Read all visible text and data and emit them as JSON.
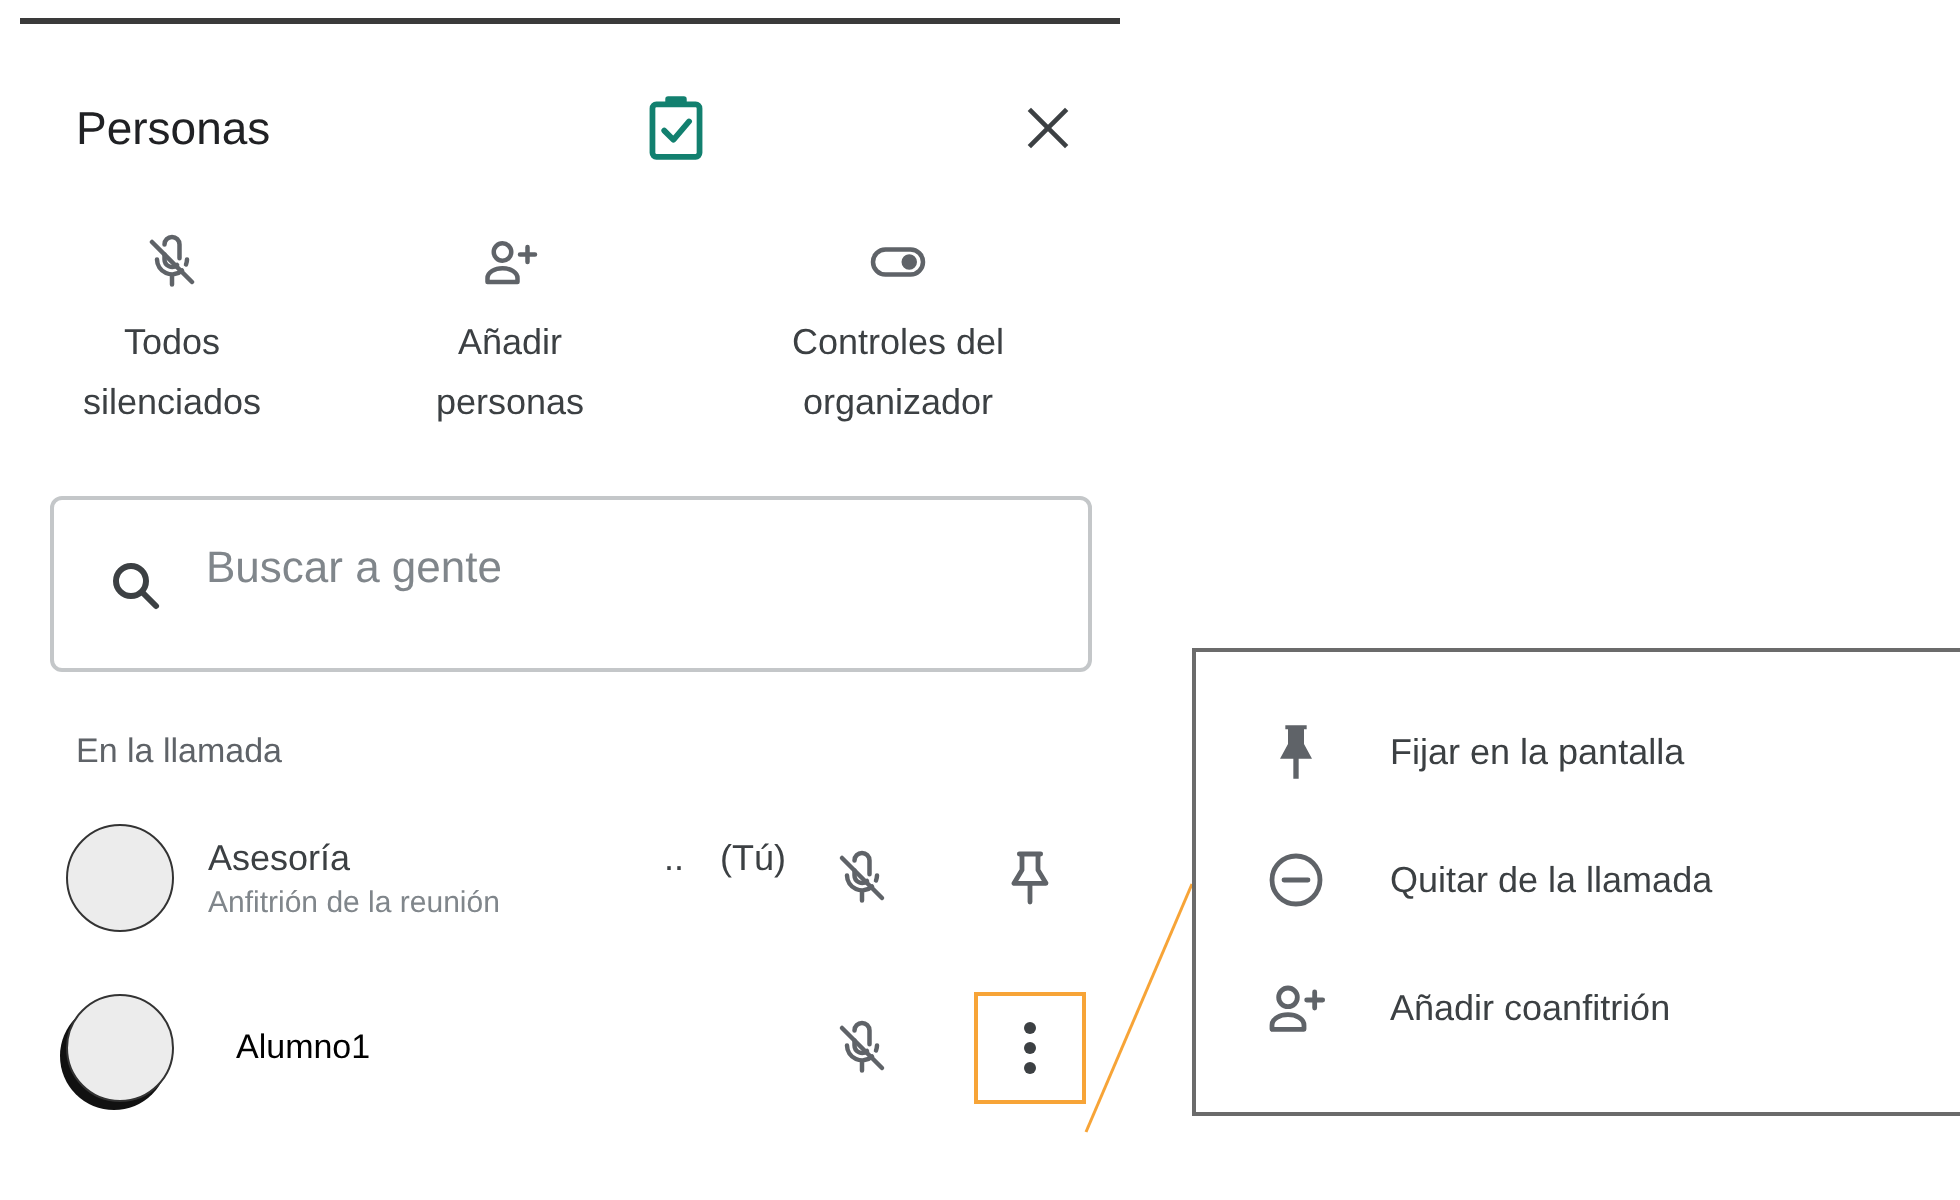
{
  "panel": {
    "title": "Personas",
    "actions": [
      {
        "kind": "mute",
        "lines": [
          "Todos",
          "silenciados"
        ]
      },
      {
        "kind": "add-person",
        "lines": [
          "Añadir",
          "personas"
        ]
      },
      {
        "kind": "toggle",
        "lines": [
          "Controles del",
          "organizador"
        ]
      }
    ],
    "search": {
      "placeholder": "Buscar a gente"
    },
    "section_label": "En la llamada",
    "participants": [
      {
        "name": "Asesoría",
        "name_tail": "..",
        "tag": "(Tú)",
        "subtitle": "Anfitrión de la reunión",
        "kind": "pin",
        "highlighted": false
      },
      {
        "name": "Alumno1",
        "kind": "more",
        "highlighted": true
      }
    ]
  },
  "callout": {
    "items": [
      {
        "kind": "pin",
        "label": "Fijar en la pantalla"
      },
      {
        "kind": "remove",
        "label": "Quitar de la llamada"
      },
      {
        "kind": "add-person",
        "label": "Añadir coanfitrión"
      }
    ]
  }
}
